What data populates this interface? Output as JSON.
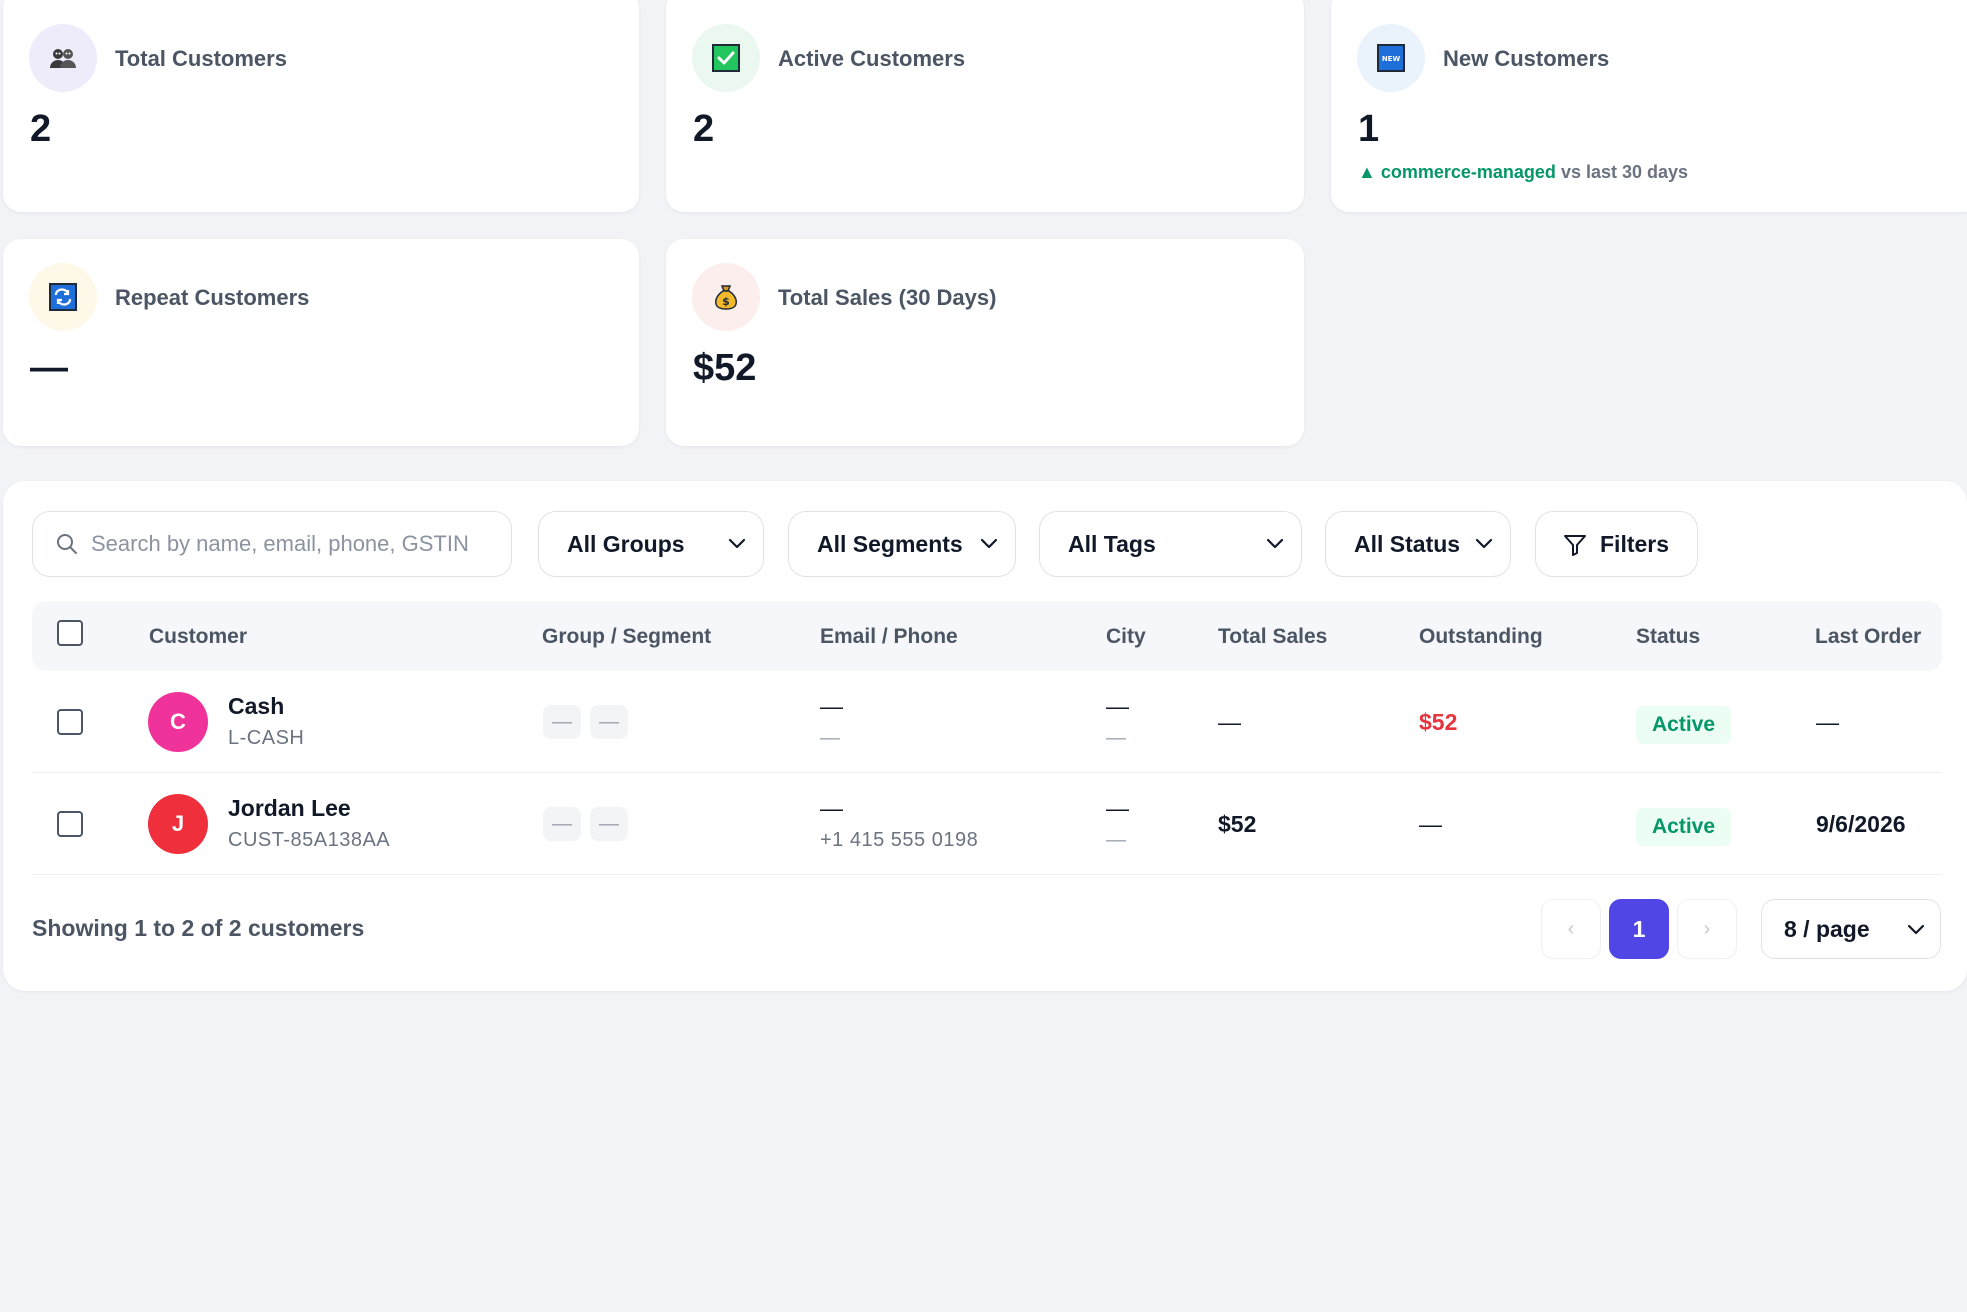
{
  "stats": [
    {
      "label": "Total Customers",
      "value": "2",
      "icon": "users-icon"
    },
    {
      "label": "Active Customers",
      "value": "2",
      "icon": "check-mark-icon",
      "icon_bg": "#22c55e"
    },
    {
      "label": "New Customers",
      "value": "1",
      "icon": "new-badge-icon",
      "icon_bg": "#1e6fd9",
      "trend_accent": "commerce-managed",
      "trend_rest": "vs last 30 days"
    },
    {
      "label": "Repeat Customers",
      "value": "—",
      "icon": "repeat-icon",
      "icon_bg": "#1e6fd9"
    },
    {
      "label": "Total Sales (30 Days)",
      "value": "$52",
      "icon": "money-bag-icon"
    }
  ],
  "toolbar": {
    "search_placeholder": "Search by name, email, phone, GSTIN",
    "groups": "All Groups",
    "segments": "All Segments",
    "tags": "All Tags",
    "status": "All Status",
    "filters": "Filters"
  },
  "table": {
    "columns": [
      "Customer",
      "Group / Segment",
      "Email / Phone",
      "City",
      "Total Sales",
      "Outstanding",
      "Status",
      "Last Order"
    ],
    "rows": [
      {
        "initial": "C",
        "avatar_color": "#f0339a",
        "name": "Cash",
        "code": "L-CASH",
        "group": "—",
        "segment": "—",
        "email": "—",
        "phone": "—",
        "city": "—",
        "city_sub": "—",
        "total_sales": "—",
        "outstanding": "$52",
        "status": "Active",
        "last_order": "—"
      },
      {
        "initial": "J",
        "avatar_color": "#ef2f3c",
        "name": "Jordan Lee",
        "code": "CUST-85A138AA",
        "group": "—",
        "segment": "—",
        "email": "—",
        "phone": "+1 415 555 0198",
        "city": "—",
        "city_sub": "—",
        "total_sales": "$52",
        "outstanding": "—",
        "status": "Active",
        "last_order": "9/6/2026"
      }
    ]
  },
  "footer": {
    "showing": "Showing 1 to 2 of 2 customers",
    "prev": "‹",
    "page": "1",
    "next": "›",
    "page_size": "8 / page"
  },
  "colors": {
    "accent": "#5046e5",
    "success": "#059669",
    "danger": "#e5343d"
  }
}
